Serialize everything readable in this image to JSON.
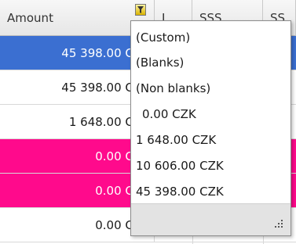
{
  "grid": {
    "columns": [
      "Amount",
      "I",
      "SSS",
      "SS"
    ],
    "rows": [
      {
        "amount": "45 398.00 CZK",
        "style": "selected"
      },
      {
        "amount": "45 398.00 CZK",
        "style": "normal"
      },
      {
        "amount": "1 648.00 CZK",
        "style": "normal"
      },
      {
        "amount": "0.00 CZK",
        "style": "magenta"
      },
      {
        "amount": "0.00 CZK",
        "style": "magenta"
      },
      {
        "amount": "0.00 CZK",
        "style": "normal"
      }
    ]
  },
  "filter_popup": {
    "options": [
      "(Custom)",
      "(Blanks)",
      "(Non blanks)",
      "0.00 CZK",
      "1 648.00 CZK",
      "10 606.00 CZK",
      "45 398.00 CZK"
    ]
  },
  "colors": {
    "selected_row": "#3b6fd1",
    "magenta_row": "#ff0a8c",
    "header": "#ececec",
    "popup_footer": "#e3e3e3"
  },
  "icons": {
    "filter": "funnel-icon",
    "resize": "resize-grip-icon"
  }
}
